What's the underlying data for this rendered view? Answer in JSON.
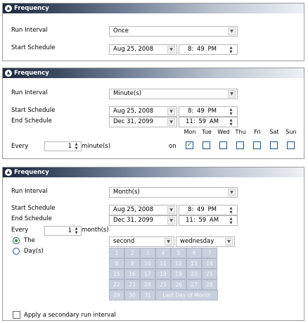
{
  "panels": [
    {
      "title": "Frequency",
      "run_interval_label": "Run Interval",
      "run_interval_value": "Once",
      "start_schedule_label": "Start Schedule",
      "start_date": "Aug 25, 2008",
      "start_time": "8: 49 PM"
    },
    {
      "title": "Frequency",
      "run_interval_label": "Run Interval",
      "run_interval_value": "Minute(s)",
      "start_schedule_label": "Start Schedule",
      "start_date": "Aug 25, 2008",
      "start_time": "8: 49 PM",
      "end_schedule_label": "End Schedule",
      "end_date": "Dec 31, 2099",
      "end_time": "11: 59 AM",
      "every_label": "Every",
      "every_value": "1",
      "every_unit": "minute(s)",
      "on_label": "on",
      "days": [
        {
          "label": "Mon",
          "checked": true
        },
        {
          "label": "Tue",
          "checked": false
        },
        {
          "label": "Wed",
          "checked": false
        },
        {
          "label": "Thu",
          "checked": false
        },
        {
          "label": "Fri",
          "checked": false
        },
        {
          "label": "Sat",
          "checked": false
        },
        {
          "label": "Sun",
          "checked": false
        }
      ]
    },
    {
      "title": "Frequency",
      "run_interval_label": "Run Interval",
      "run_interval_value": "Month(s)",
      "start_schedule_label": "Start Schedule",
      "start_date": "Aug 25, 2008",
      "start_time": "8: 49 PM",
      "end_schedule_label": "End Schedule",
      "end_date": "Dec 31, 2099",
      "end_time": "11: 59 AM",
      "every_label": "Every",
      "every_value": "1",
      "every_unit": "month(s)",
      "option_the": "The",
      "option_days": "Day(s)",
      "ordinal_value": "second",
      "weekday_value": "wednesday",
      "month_days": [
        "1",
        "2",
        "3",
        "4",
        "5",
        "6",
        "7",
        "8",
        "9",
        "10",
        "11",
        "12",
        "13",
        "14",
        "15",
        "16",
        "17",
        "18",
        "19",
        "20",
        "21",
        "22",
        "23",
        "24",
        "25",
        "26",
        "27",
        "28",
        "29",
        "30",
        "31"
      ],
      "last_day_label": "Last Day of Month",
      "secondary_label": "Apply a secondary run interval"
    }
  ],
  "icons": {
    "collapse": "chevron-up-circle-icon",
    "dropdown": "chevron-down-icon",
    "spinner": "spinner-arrows-icon"
  },
  "colors": {
    "title_bar_dark": "#1d2a3e",
    "check_green": "#1e8a1e",
    "disabled_cell": "#c8d0de"
  }
}
